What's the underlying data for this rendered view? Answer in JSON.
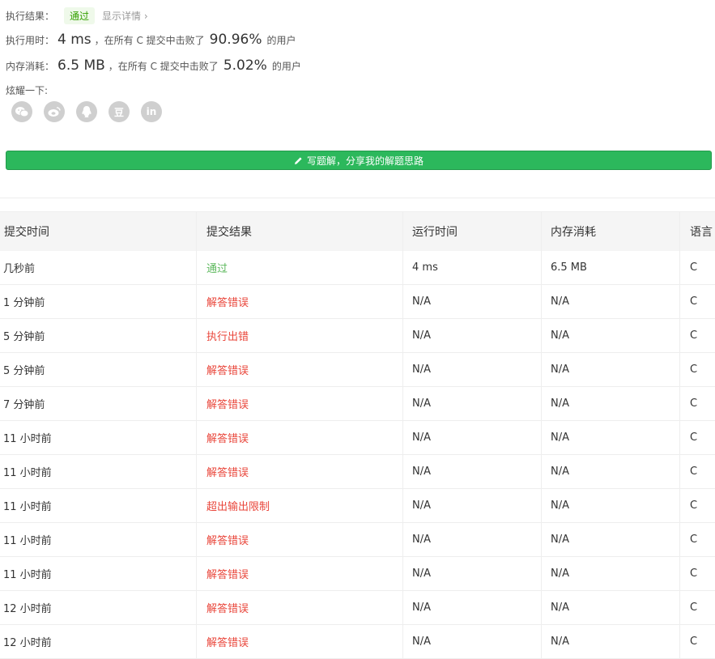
{
  "summary": {
    "result_label": "执行结果：",
    "result_badge": "通过",
    "details_link": "显示详情 ›",
    "runtime": {
      "label": "执行用时：",
      "value": "4 ms",
      "text_pre": "，在所有 C 提交中击败了",
      "percent": "90.96%",
      "text_post": "的用户"
    },
    "memory": {
      "label": "内存消耗：",
      "value": "6.5 MB",
      "text_pre": "，在所有 C 提交中击败了",
      "percent": "5.02%",
      "text_post": "的用户"
    },
    "share_label": "炫耀一下:",
    "share_icons": [
      "wechat-icon",
      "weibo-icon",
      "qq-icon",
      "douban-icon",
      "linkedin-icon"
    ],
    "share_glyphs": [
      "",
      "",
      "",
      "豆",
      "in"
    ],
    "solution_button": "写题解，分享我的解题思路"
  },
  "table": {
    "headers": [
      "提交时间",
      "提交结果",
      "运行时间",
      "内存消耗",
      "语言"
    ],
    "rows": [
      {
        "time": "几秒前",
        "result": "通过",
        "status": "ok",
        "runtime": "4 ms",
        "memory": "6.5 MB",
        "lang": "C"
      },
      {
        "time": "1 分钟前",
        "result": "解答错误",
        "status": "err",
        "runtime": "N/A",
        "memory": "N/A",
        "lang": "C"
      },
      {
        "time": "5 分钟前",
        "result": "执行出错",
        "status": "err",
        "runtime": "N/A",
        "memory": "N/A",
        "lang": "C"
      },
      {
        "time": "5 分钟前",
        "result": "解答错误",
        "status": "err",
        "runtime": "N/A",
        "memory": "N/A",
        "lang": "C"
      },
      {
        "time": "7 分钟前",
        "result": "解答错误",
        "status": "err",
        "runtime": "N/A",
        "memory": "N/A",
        "lang": "C"
      },
      {
        "time": "11 小时前",
        "result": "解答错误",
        "status": "err",
        "runtime": "N/A",
        "memory": "N/A",
        "lang": "C"
      },
      {
        "time": "11 小时前",
        "result": "解答错误",
        "status": "err",
        "runtime": "N/A",
        "memory": "N/A",
        "lang": "C"
      },
      {
        "time": "11 小时前",
        "result": "超出输出限制",
        "status": "err",
        "runtime": "N/A",
        "memory": "N/A",
        "lang": "C"
      },
      {
        "time": "11 小时前",
        "result": "解答错误",
        "status": "err",
        "runtime": "N/A",
        "memory": "N/A",
        "lang": "C"
      },
      {
        "time": "11 小时前",
        "result": "解答错误",
        "status": "err",
        "runtime": "N/A",
        "memory": "N/A",
        "lang": "C"
      },
      {
        "time": "12 小时前",
        "result": "解答错误",
        "status": "err",
        "runtime": "N/A",
        "memory": "N/A",
        "lang": "C"
      },
      {
        "time": "12 小时前",
        "result": "解答错误",
        "status": "err",
        "runtime": "N/A",
        "memory": "N/A",
        "lang": "C"
      }
    ]
  },
  "colors": {
    "accept": "#5cb85c",
    "error": "#e9453a",
    "button": "#2cb85c",
    "icon_bg": "#cfcfcf"
  }
}
